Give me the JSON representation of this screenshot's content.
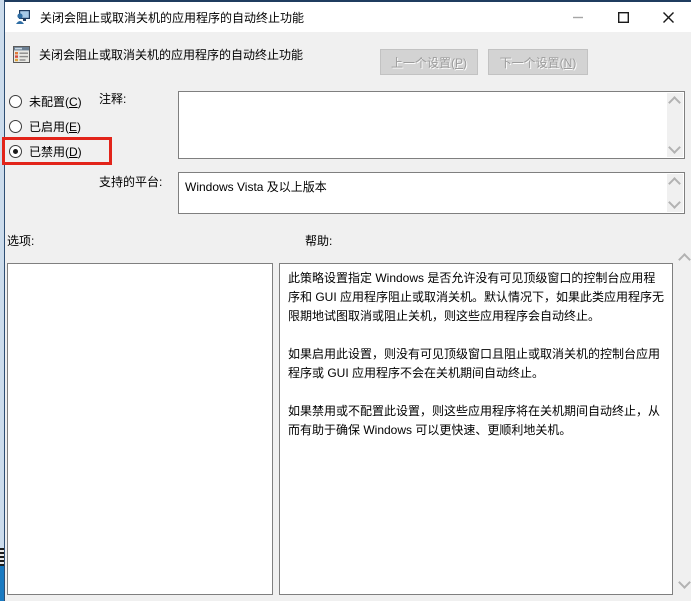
{
  "window": {
    "title": "关闭会阻止或取消关机的应用程序的自动终止功能"
  },
  "toolbar": {
    "setting_title": "关闭会阻止或取消关机的应用程序的自动终止功能",
    "prev_button": {
      "pre": "上一个设置(",
      "key": "P",
      "post": ")",
      "enabled": false
    },
    "next_button": {
      "pre": "下一个设置(",
      "key": "N",
      "post": ")",
      "enabled": false
    }
  },
  "radios": [
    {
      "pre": "未配置(",
      "key": "C",
      "post": ")",
      "selected": false
    },
    {
      "pre": "已启用(",
      "key": "E",
      "post": ")",
      "selected": false
    },
    {
      "pre": "已禁用(",
      "key": "D",
      "post": ")",
      "selected": true,
      "highlighted": true
    }
  ],
  "comment": {
    "label": "注释:",
    "value": ""
  },
  "platform": {
    "label": "支持的平台:",
    "value": "Windows Vista 及以上版本"
  },
  "options_panel": {
    "label": "选项:"
  },
  "help_panel": {
    "label": "帮助:",
    "paragraphs": [
      "此策略设置指定 Windows 是否允许没有可见顶级窗口的控制台应用程序和 GUI 应用程序阻止或取消关机。默认情况下，如果此类应用程序无限期地试图取消或阻止关机，则这些应用程序会自动终止。",
      "如果启用此设置，则没有可见顶级窗口且阻止或取消关机的控制台应用程序或 GUI 应用程序不会在关机期间自动终止。",
      "如果禁用或不配置此设置，则这些应用程序将在关机期间自动终止，从而有助于确保 Windows 可以更快速、更顺利地关机。"
    ]
  },
  "annotation": {
    "type": "highlight-rectangle",
    "color": "#e2241a",
    "target": "已禁用(D)"
  },
  "colors": {
    "window_border": "#1f3c5f",
    "panel_bg": "#f0f0f0",
    "box_border": "#7f7f7f",
    "disabled_button_bg": "#d3d3d3",
    "disabled_button_text": "#9c9c9c",
    "annotation_red": "#e2241a"
  }
}
